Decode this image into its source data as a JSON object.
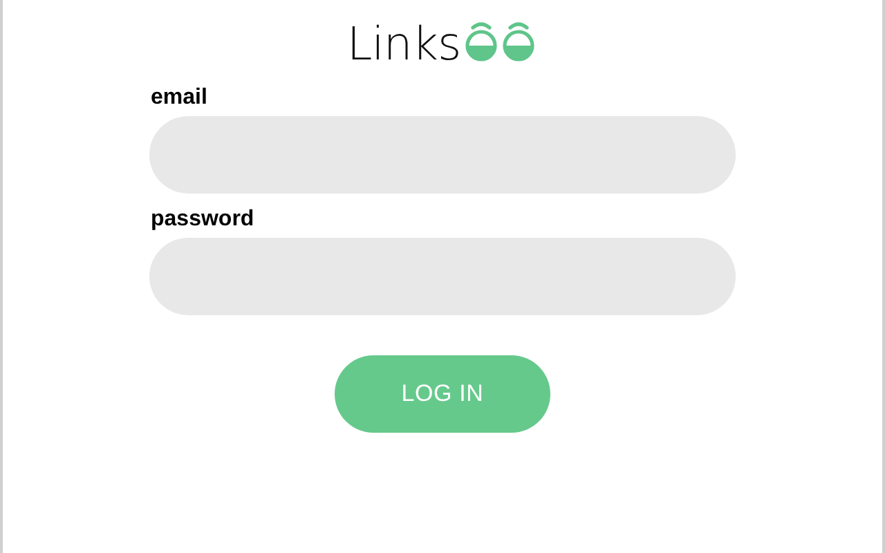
{
  "logo": {
    "text": "Links"
  },
  "fields": [
    {
      "label": "email"
    },
    {
      "label": "password"
    }
  ],
  "button": {
    "label": "LOG IN"
  }
}
